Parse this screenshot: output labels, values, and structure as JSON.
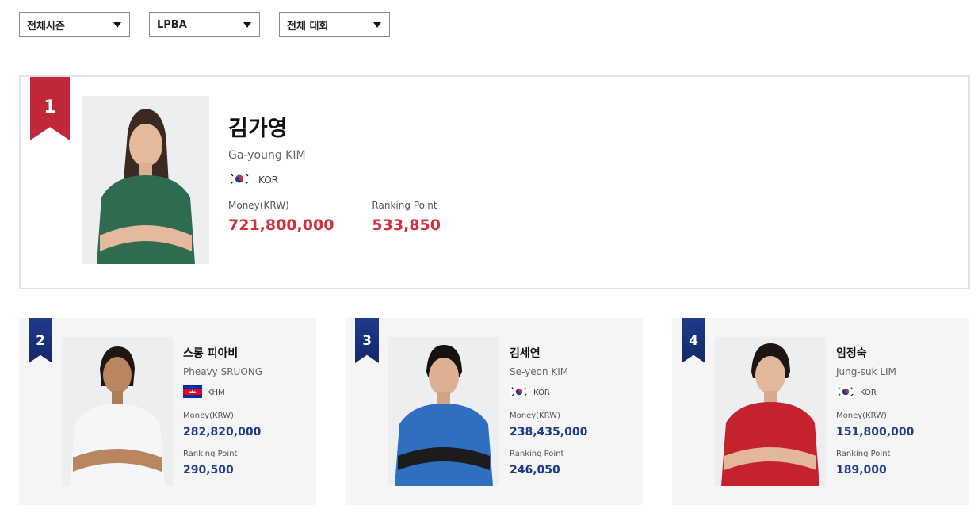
{
  "filters": [
    {
      "value": "전체시즌"
    },
    {
      "value": "LPBA"
    },
    {
      "value": "전체 대회"
    }
  ],
  "labels": {
    "money": "Money(KRW)",
    "ranking_point": "Ranking Point"
  },
  "players": [
    {
      "rank": "1",
      "name_ko": "김가영",
      "name_en": "Ga-young KIM",
      "country": "KOR",
      "money": "721,800,000",
      "points": "533,850",
      "shirt_color": "#2e6b4f"
    },
    {
      "rank": "2",
      "name_ko": "스롱 피아비",
      "name_en": "Pheavy SRUONG",
      "country": "KHM",
      "money": "282,820,000",
      "points": "290,500",
      "shirt_color": "#f4f6f8"
    },
    {
      "rank": "3",
      "name_ko": "김세연",
      "name_en": "Se-yeon KIM",
      "country": "KOR",
      "money": "238,435,000",
      "points": "246,050",
      "shirt_color": "#2f6fc0"
    },
    {
      "rank": "4",
      "name_ko": "임정숙",
      "name_en": "Jung-suk LIM",
      "country": "KOR",
      "money": "151,800,000",
      "points": "189,000",
      "shirt_color": "#c4232e"
    }
  ],
  "colors": {
    "rank1_ribbon": "#c0283a",
    "ribbon": "#1e3a8a",
    "money_top": "#d1323e",
    "money": "#1f3c88"
  }
}
